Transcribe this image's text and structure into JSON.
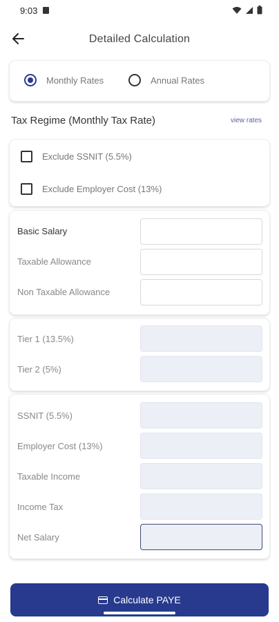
{
  "status_bar": {
    "time": "9:03"
  },
  "app_bar": {
    "title": "Detailed Calculation"
  },
  "rate_options": [
    {
      "label": "Monthly Rates",
      "selected": true
    },
    {
      "label": "Annual Rates",
      "selected": false
    }
  ],
  "regime": {
    "title": "Tax Regime (Monthly Tax Rate)",
    "view_rates": "view rates"
  },
  "exclusions": [
    {
      "label": "Exclude SSNIT (5.5%)",
      "checked": false
    },
    {
      "label": "Exclude Employer Cost (13%)",
      "checked": false
    }
  ],
  "salary_fields": [
    {
      "label": "Basic Salary",
      "value": ""
    },
    {
      "label": "Taxable Allowance",
      "value": ""
    },
    {
      "label": "Non Taxable Allowance",
      "value": ""
    }
  ],
  "tier_fields": [
    {
      "label": "Tier 1 (13.5%)",
      "value": ""
    },
    {
      "label": "Tier 2 (5%)",
      "value": ""
    }
  ],
  "result_fields": [
    {
      "label": "SSNIT (5.5%)",
      "value": ""
    },
    {
      "label": "Employer Cost (13%)",
      "value": ""
    },
    {
      "label": "Taxable Income",
      "value": ""
    },
    {
      "label": "Income Tax",
      "value": ""
    },
    {
      "label": "Net Salary",
      "value": ""
    }
  ],
  "action": {
    "label": "Calculate PAYE"
  },
  "colors": {
    "primary": "#273a8e",
    "readonly_field": "#eceff5",
    "link": "#5a5f9e"
  }
}
